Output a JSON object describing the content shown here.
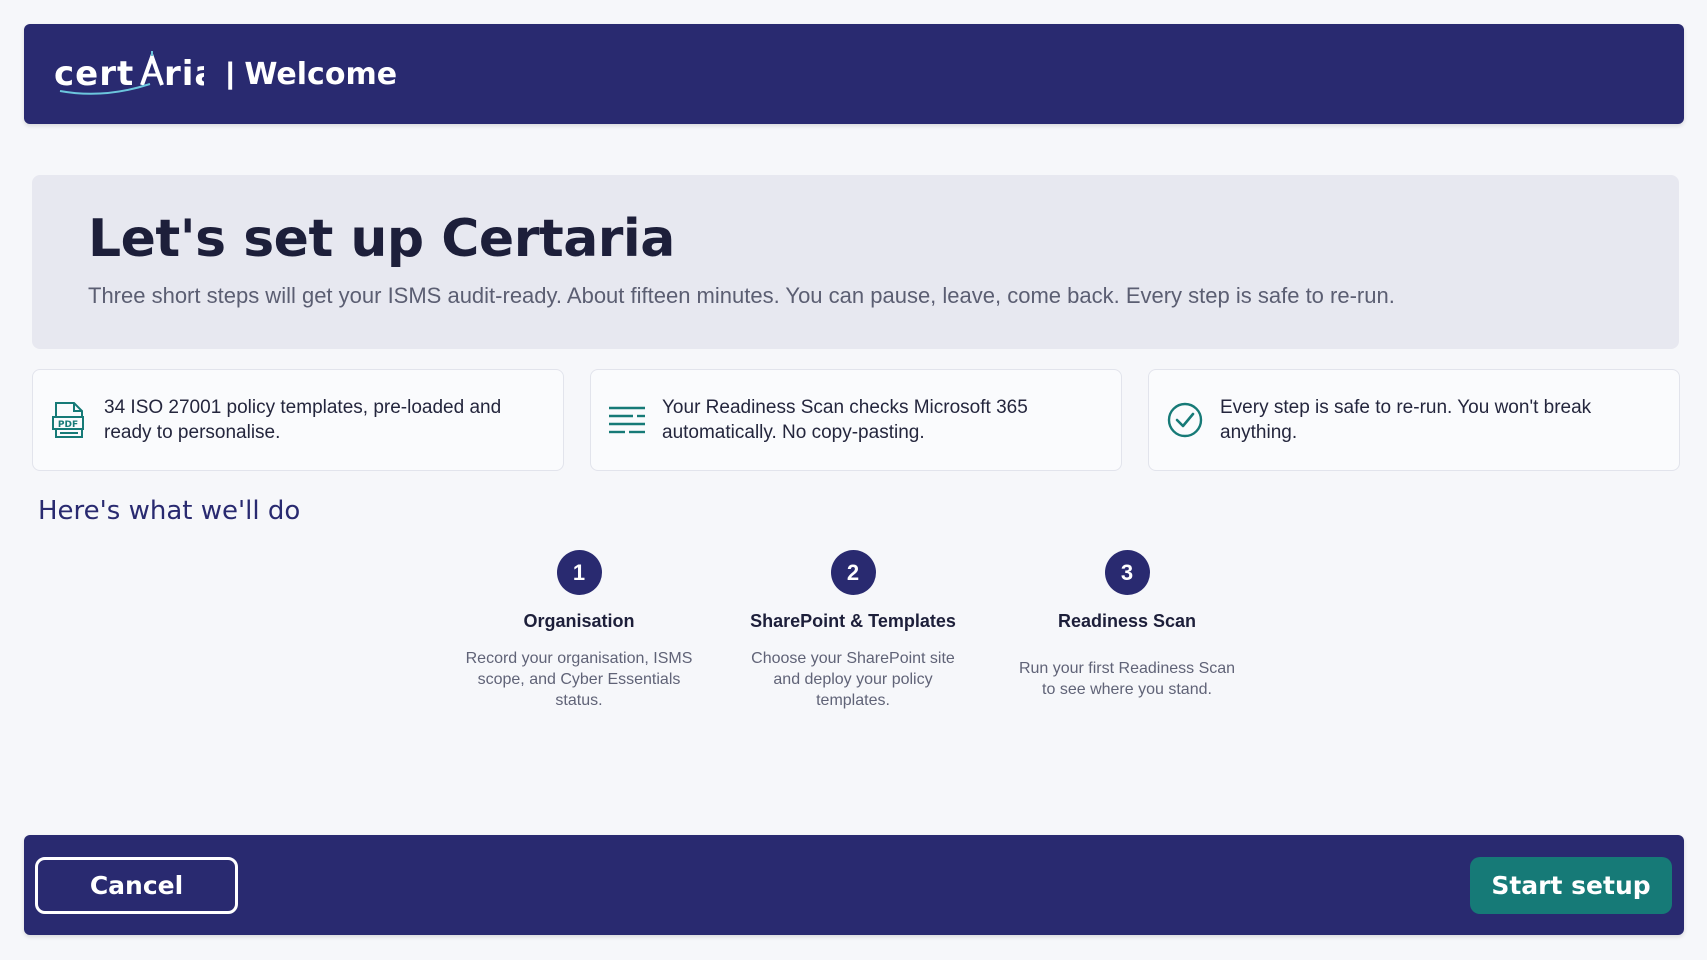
{
  "header": {
    "brand": "certaria",
    "separator": "|",
    "title": "Welcome"
  },
  "hero": {
    "heading": "Let's set up Certaria",
    "subtitle": "Three short steps will get your ISMS audit-ready. About fifteen minutes. You can pause, leave, come back. Every step is safe to re-run."
  },
  "cards": [
    {
      "icon": "pdf-document-icon",
      "text": "34 ISO 27001 policy templates, pre-loaded and ready to personalise."
    },
    {
      "icon": "list-lines-icon",
      "text": "Your Readiness Scan checks Microsoft 365 automatically. No copy-pasting."
    },
    {
      "icon": "check-circle-icon",
      "text": "Every step is safe to re-run. You won't break anything."
    }
  ],
  "section": {
    "title": "Here's what we'll do"
  },
  "steps": [
    {
      "number": "1",
      "title": "Organisation",
      "description": "Record your organisation, ISMS scope, and Cyber Essentials status."
    },
    {
      "number": "2",
      "title": "SharePoint & Templates",
      "description": "Choose your SharePoint site and deploy your policy templates."
    },
    {
      "number": "3",
      "title": "Readiness Scan",
      "description": "Run your first Readiness Scan to see where you stand."
    }
  ],
  "footer": {
    "cancel_label": "Cancel",
    "start_label": "Start setup"
  },
  "colors": {
    "primary": "#292a70",
    "accent": "#167a77",
    "hero_bg": "#e7e8f0"
  }
}
